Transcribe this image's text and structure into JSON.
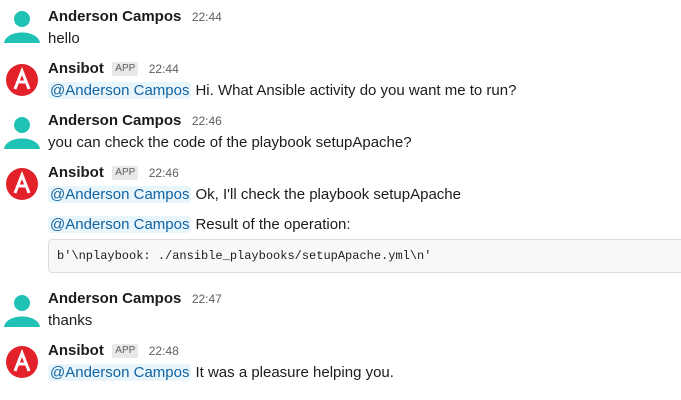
{
  "messages": [
    {
      "author": "Anderson Campos",
      "time": "22:44",
      "text": "hello"
    },
    {
      "author": "Ansibot",
      "badge": "APP",
      "time": "22:44",
      "mention": "@Anderson Campos",
      "text": "Hi. What Ansible activity do you want me to run?"
    },
    {
      "author": "Anderson Campos",
      "time": "22:46",
      "text": "you can check the code of the playbook setupApache?"
    },
    {
      "author": "Ansibot",
      "badge": "APP",
      "time": "22:46",
      "line1_mention": "@Anderson Campos",
      "line1_text": "Ok, I'll check the playbook setupApache",
      "line2_mention": "@Anderson Campos",
      "line2_text": "Result of the operation:",
      "code": "b'\\nplaybook: ./ansible_playbooks/setupApache.yml\\n'"
    },
    {
      "author": "Anderson Campos",
      "time": "22:47",
      "text": "thanks"
    },
    {
      "author": "Ansibot",
      "badge": "APP",
      "time": "22:48",
      "mention": "@Anderson Campos",
      "text": "It was a pleasure helping you."
    }
  ],
  "colors": {
    "user_avatar": "#1fc2b5",
    "bot_avatar": "#e3212b",
    "mention_bg": "#e8f5fa",
    "mention_text": "#1264a3"
  },
  "icons": {
    "user_avatar": "person-icon",
    "bot_avatar": "ansible-logo-icon"
  }
}
